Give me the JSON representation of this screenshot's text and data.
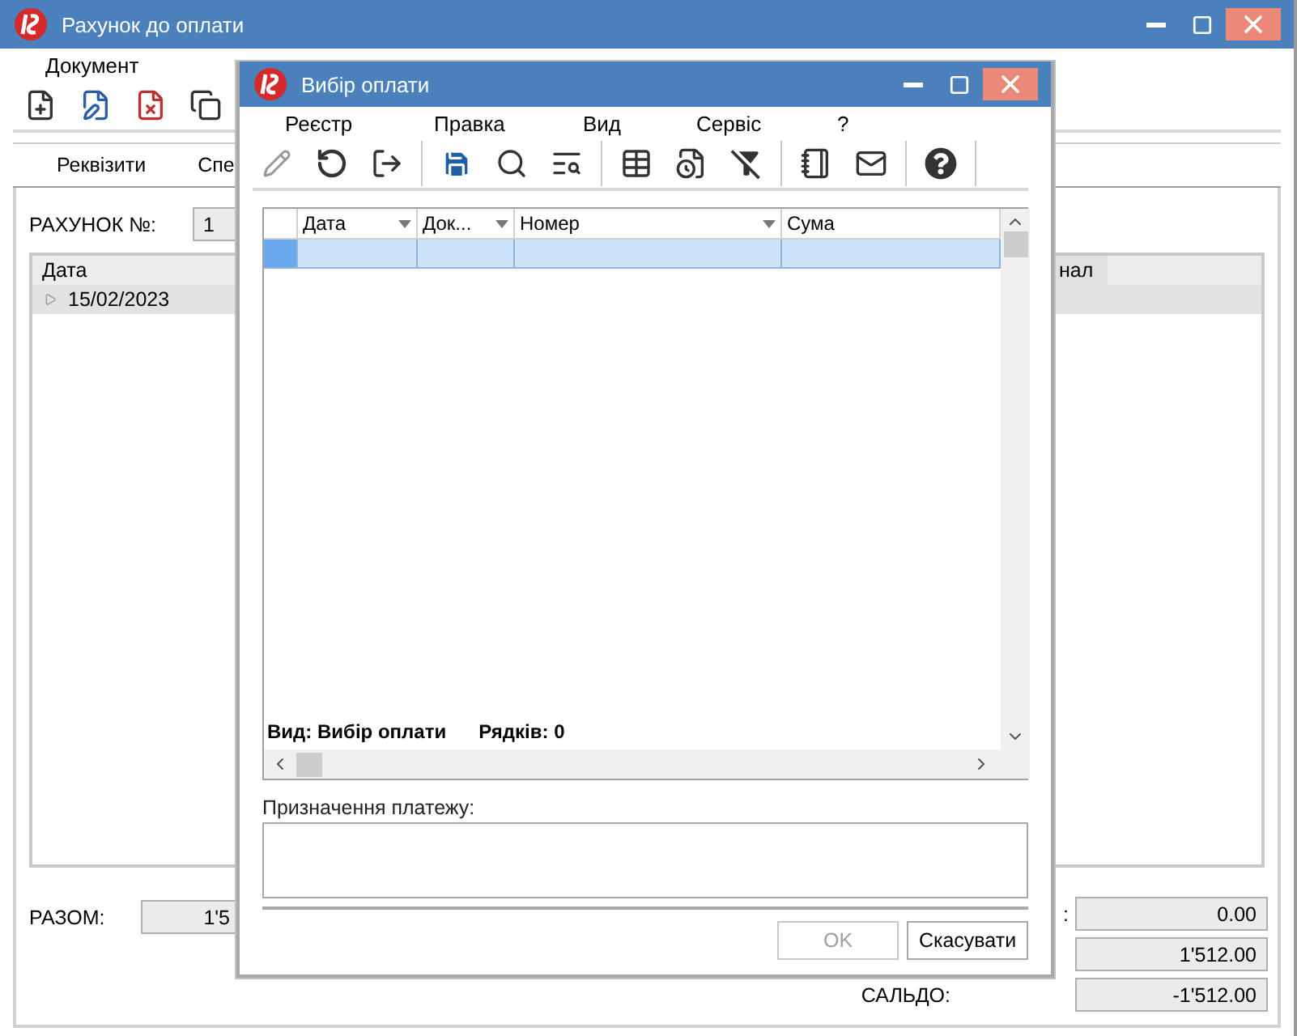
{
  "main_window": {
    "title": "Рахунок до оплати",
    "menu": [
      "Документ"
    ],
    "tabs": [
      "Реквізити",
      "Спе"
    ],
    "invoice_number": {
      "label": "РАХУНОК №:",
      "value": "1"
    },
    "table": {
      "columns": [
        "Дата",
        "нал"
      ],
      "rows": [
        {
          "cells": [
            "15/02/2023"
          ],
          "selected": true,
          "expanded": false
        }
      ]
    },
    "total": {
      "label": "РАЗОМ:",
      "value": "1'5"
    },
    "balances": [
      {
        "label": ":",
        "value": "0.00"
      },
      {
        "value": "1'512.00"
      },
      {
        "label": "САЛЬДО:",
        "value": "-1'512.00"
      }
    ]
  },
  "dialog": {
    "title": "Вибір оплати",
    "menu": [
      "Реєстр",
      "Правка",
      "Вид",
      "Сервіс",
      "?"
    ],
    "grid": {
      "columns": [
        {
          "label": "Дата",
          "filter": true
        },
        {
          "label": "Док...",
          "filter": true
        },
        {
          "label": "Номер",
          "filter": true
        },
        {
          "label": "Сума",
          "filter": false
        }
      ],
      "rows": [
        {
          "selected": true
        }
      ]
    },
    "status": {
      "view": "Вид: Вибір оплати",
      "count": "Рядків: 0"
    },
    "purpose": {
      "label": "Призначення платежу:"
    },
    "buttons": [
      {
        "label": "OK",
        "disabled": true
      },
      {
        "label": "Скасувати",
        "disabled": false
      }
    ]
  }
}
